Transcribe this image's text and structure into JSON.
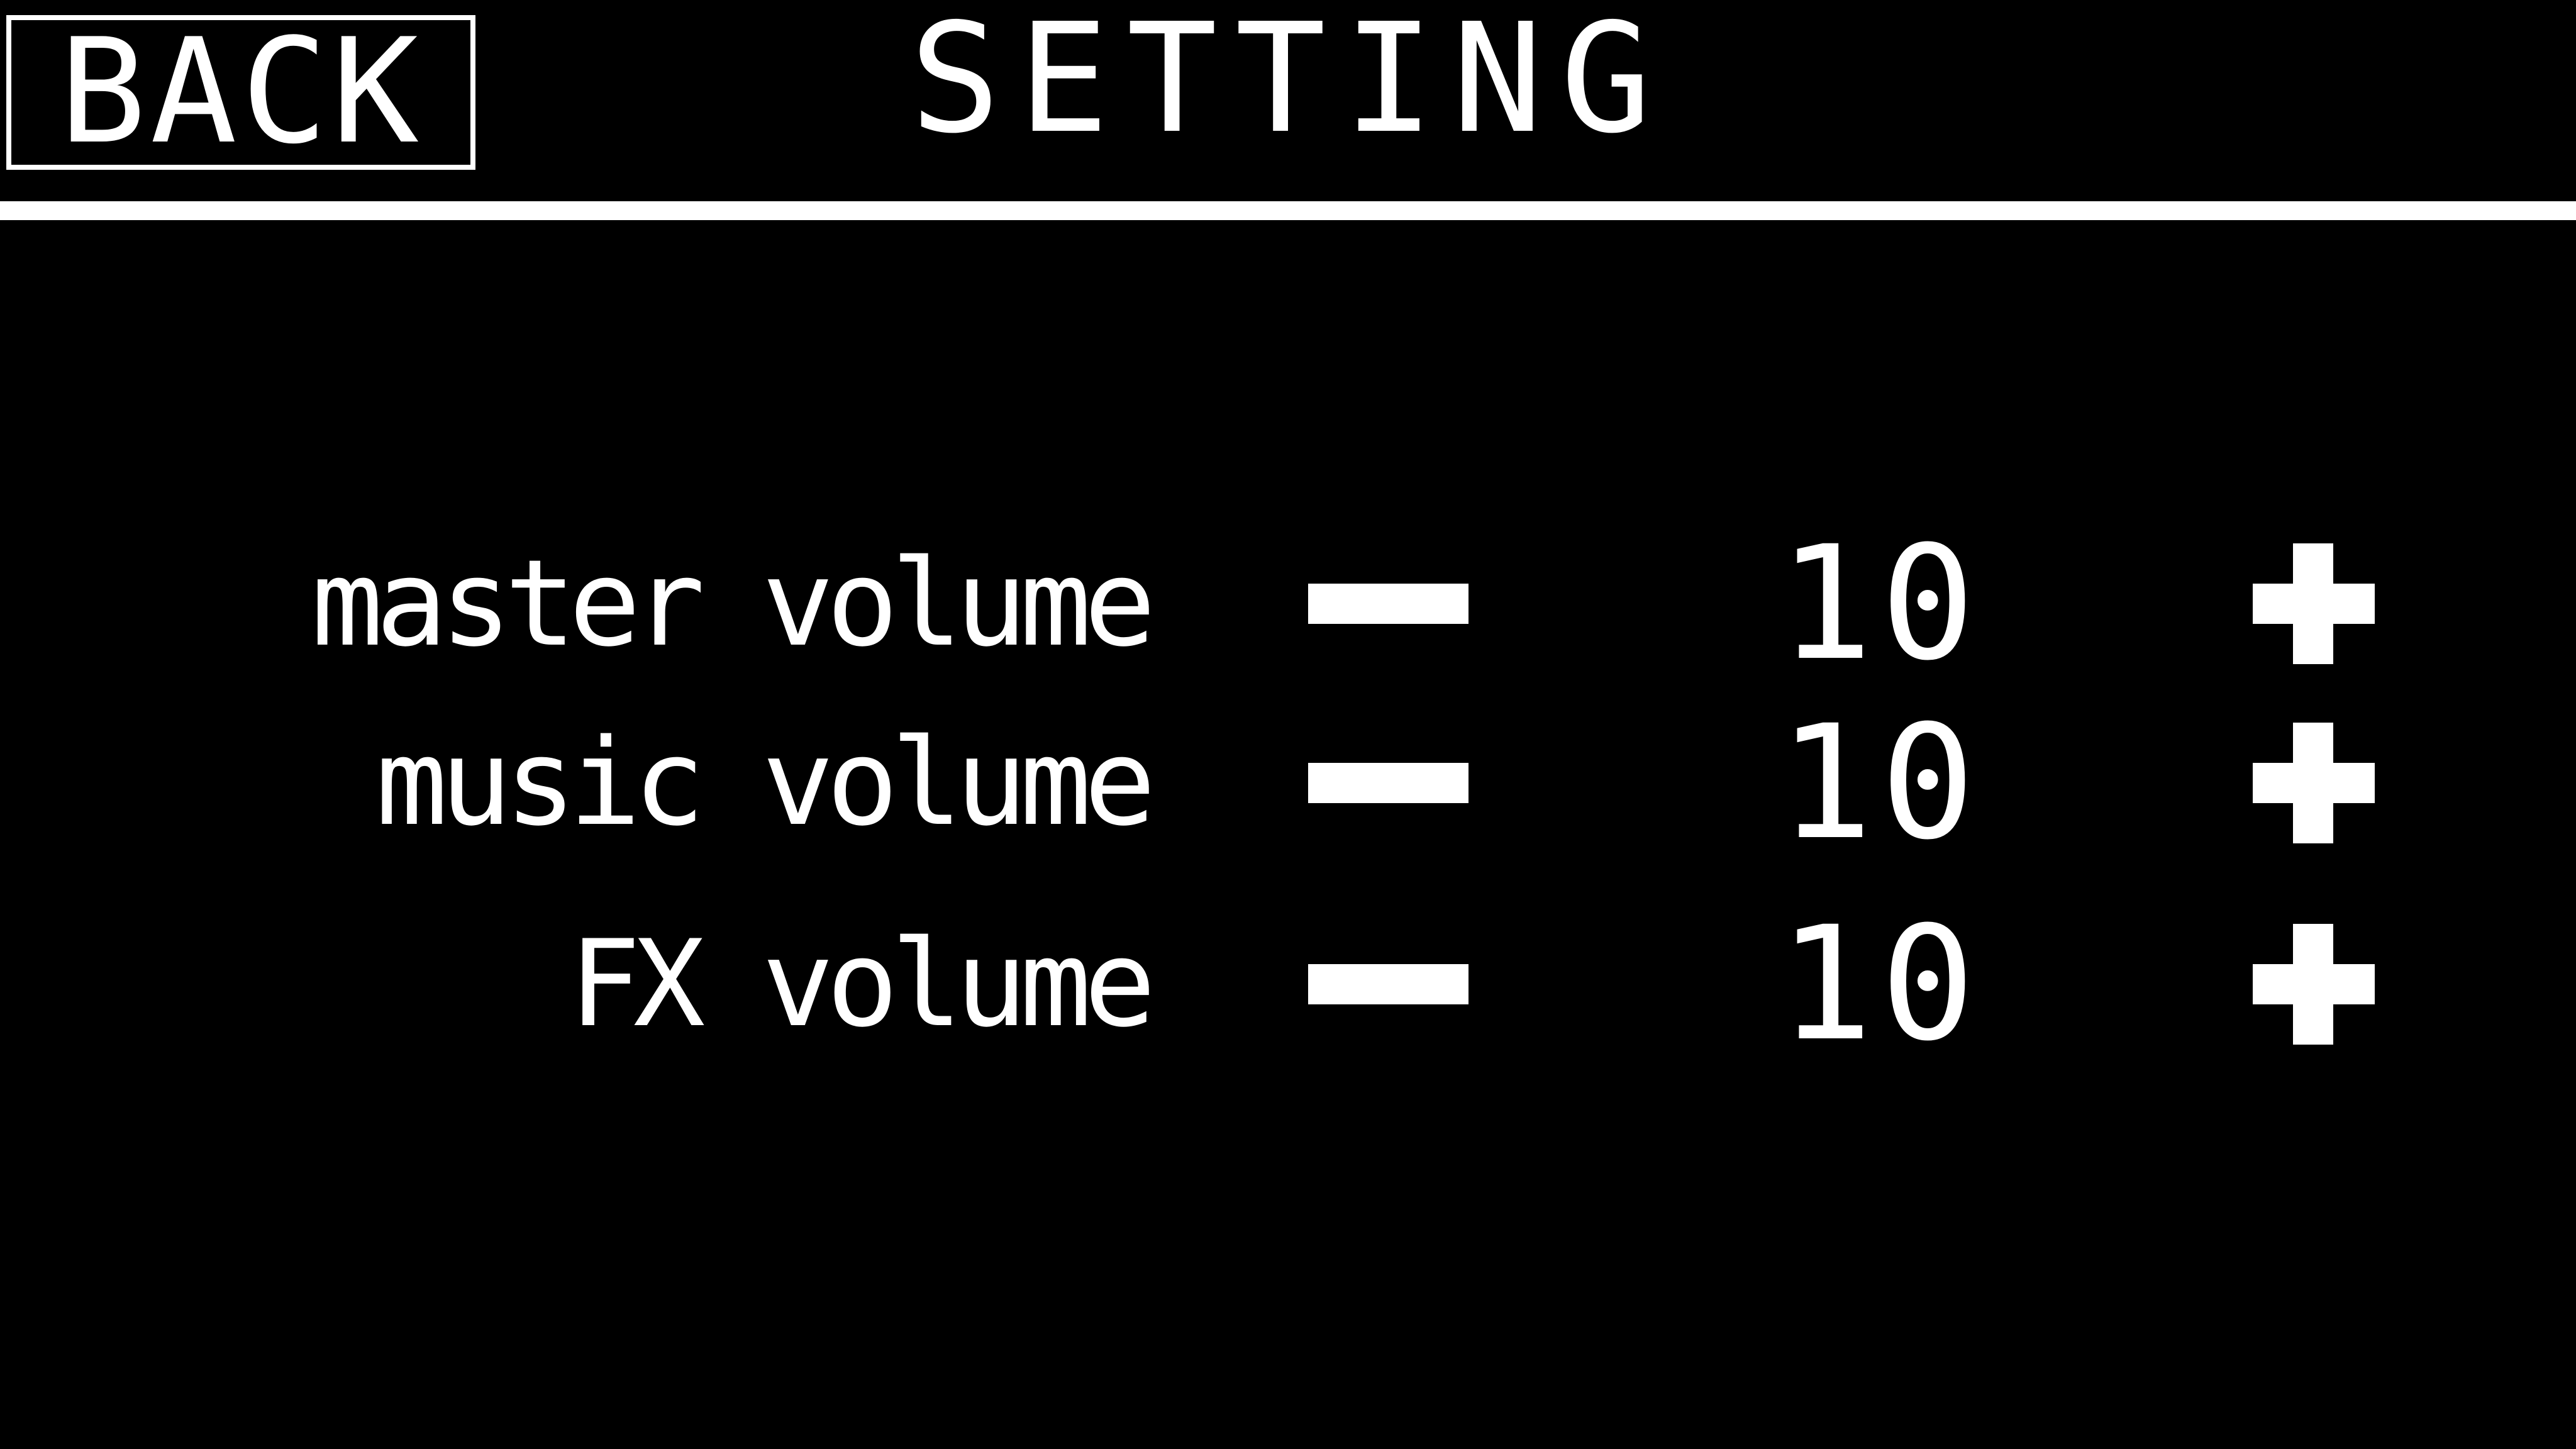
{
  "header": {
    "back_label": "BACK",
    "title": "SETTING"
  },
  "settings": [
    {
      "label": "master volume",
      "value": "10"
    },
    {
      "label": "music volume",
      "value": "10"
    },
    {
      "label": "FX volume",
      "value": "10"
    }
  ],
  "icons": {
    "decrease": "minus-icon",
    "increase": "plus-icon"
  },
  "colors": {
    "background": "#000000",
    "foreground": "#ffffff"
  }
}
